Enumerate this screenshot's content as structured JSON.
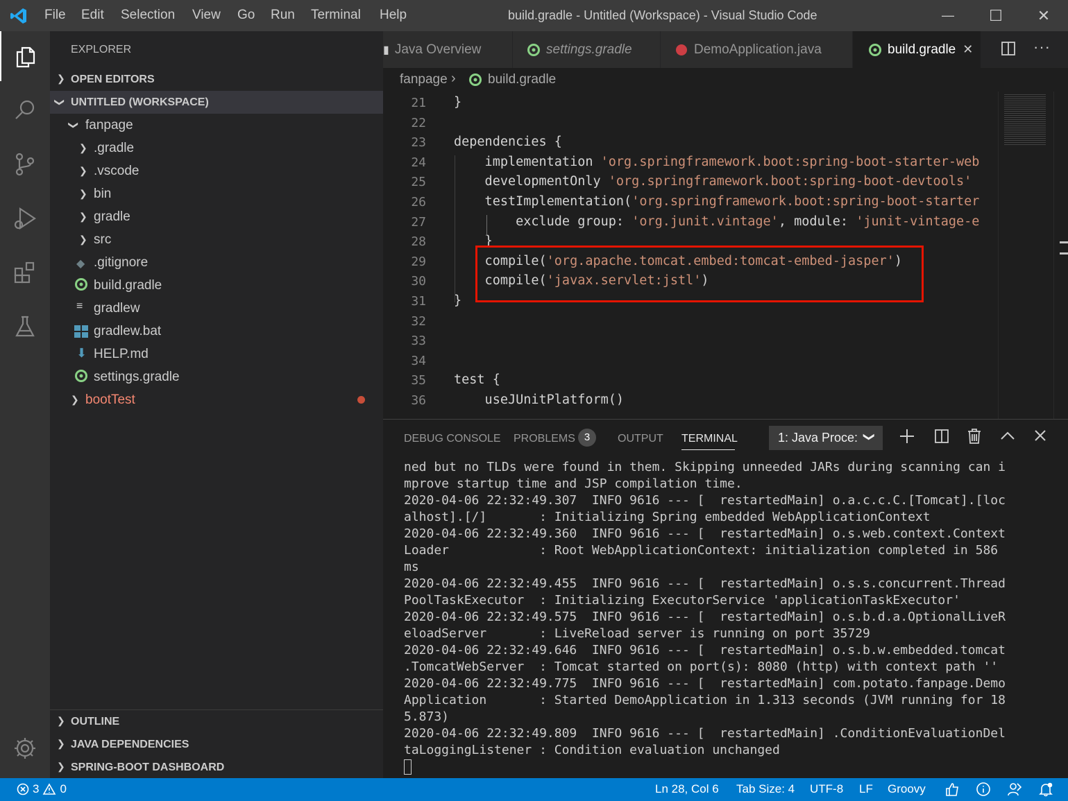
{
  "titlebar": {
    "menu": [
      "File",
      "Edit",
      "Selection",
      "View",
      "Go",
      "Run",
      "Terminal",
      "Help"
    ],
    "title": "build.gradle - Untitled (Workspace) - Visual Studio Code",
    "min": "—",
    "max": "☐",
    "close": "✕"
  },
  "sidebar": {
    "title": "EXPLORER",
    "sections": {
      "open_editors": "OPEN EDITORS",
      "workspace": "UNTITLED (WORKSPACE)",
      "outline": "OUTLINE",
      "java_deps": "JAVA DEPENDENCIES",
      "spring": "SPRING-BOOT DASHBOARD"
    },
    "root_folder": "fanpage",
    "folders": [
      ".gradle",
      ".vscode",
      "bin",
      "gradle",
      "src"
    ],
    "files": [
      ".gitignore",
      "build.gradle",
      "gradlew",
      "gradlew.bat",
      "HELP.md",
      "settings.gradle"
    ],
    "boottest": "bootTest"
  },
  "tabs": [
    {
      "label": "Java Overview"
    },
    {
      "label": "settings.gradle"
    },
    {
      "label": "DemoApplication.java"
    },
    {
      "label": "build.gradle",
      "close": "✕"
    }
  ],
  "breadcrumb": {
    "folder": "fanpage",
    "sep": "›",
    "file": "build.gradle"
  },
  "editor": {
    "lines": [
      {
        "n": "21",
        "pre": "}",
        "str": "",
        "post": ""
      },
      {
        "n": "22",
        "pre": "",
        "str": "",
        "post": ""
      },
      {
        "n": "23",
        "pre": "dependencies {",
        "str": "",
        "post": ""
      },
      {
        "n": "24",
        "pre": "    implementation ",
        "str": "'org.springframework.boot:spring-boot-starter-web",
        "post": ""
      },
      {
        "n": "25",
        "pre": "    developmentOnly ",
        "str": "'org.springframework.boot:spring-boot-devtools'",
        "post": ""
      },
      {
        "n": "26",
        "pre": "    testImplementation(",
        "str": "'org.springframework.boot:spring-boot-starter",
        "post": ""
      },
      {
        "n": "27",
        "pre": "        exclude group: ",
        "str": "'org.junit.vintage'",
        "post": ", module: 'junit-vintage-e"
      },
      {
        "n": "28",
        "pre": "    }",
        "str": "",
        "post": ""
      },
      {
        "n": "29",
        "pre": "    compile(",
        "str": "'org.apache.tomcat.embed:tomcat-embed-jasper'",
        "post": ")"
      },
      {
        "n": "30",
        "pre": "    compile(",
        "str": "'javax.servlet:jstl'",
        "post": ")"
      },
      {
        "n": "31",
        "pre": "}",
        "str": "",
        "post": ""
      },
      {
        "n": "32",
        "pre": "",
        "str": "",
        "post": ""
      },
      {
        "n": "33",
        "pre": "",
        "str": "",
        "post": ""
      },
      {
        "n": "34",
        "pre": "",
        "str": "",
        "post": ""
      },
      {
        "n": "35",
        "pre": "test {",
        "str": "",
        "post": ""
      },
      {
        "n": "36",
        "pre": "    useJUnitPlatform()",
        "str": "",
        "post": ""
      }
    ]
  },
  "panel": {
    "tabs": [
      "DEBUG CONSOLE",
      "PROBLEMS",
      "OUTPUT",
      "TERMINAL"
    ],
    "problems_count": "3",
    "terminal_select": "1: Java Proce:",
    "terminal_lines": [
      "ned but no TLDs were found in them. Skipping unneeded JARs during scanning can i",
      "mprove startup time and JSP compilation time.",
      "2020-04-06 22:32:49.307  INFO 9616 --- [  restartedMain] o.a.c.c.C.[Tomcat].[loc",
      "alhost].[/]       : Initializing Spring embedded WebApplicationContext",
      "2020-04-06 22:32:49.360  INFO 9616 --- [  restartedMain] o.s.web.context.Context",
      "Loader            : Root WebApplicationContext: initialization completed in 586",
      "ms",
      "2020-04-06 22:32:49.455  INFO 9616 --- [  restartedMain] o.s.s.concurrent.Thread",
      "PoolTaskExecutor  : Initializing ExecutorService 'applicationTaskExecutor'",
      "2020-04-06 22:32:49.575  INFO 9616 --- [  restartedMain] o.s.b.d.a.OptionalLiveR",
      "eloadServer       : LiveReload server is running on port 35729",
      "2020-04-06 22:32:49.646  INFO 9616 --- [  restartedMain] o.s.b.w.embedded.tomcat",
      ".TomcatWebServer  : Tomcat started on port(s): 8080 (http) with context path ''",
      "2020-04-06 22:32:49.775  INFO 9616 --- [  restartedMain] com.potato.fanpage.Demo",
      "Application       : Started DemoApplication in 1.313 seconds (JVM running for 18",
      "5.873)",
      "2020-04-06 22:32:49.809  INFO 9616 --- [  restartedMain] .ConditionEvaluationDel",
      "taLoggingListener : Condition evaluation unchanged"
    ]
  },
  "statusbar": {
    "errors": "3",
    "warnings": "0",
    "position": "Ln 28, Col 6",
    "tabsize": "Tab Size: 4",
    "encoding": "UTF-8",
    "eol": "LF",
    "language": "Groovy"
  },
  "colors": {
    "accent": "#007acc",
    "highlight_box": "#e51400",
    "string": "#ce9178",
    "gradle_icon": "#89d185",
    "boottest": "#f48771"
  }
}
